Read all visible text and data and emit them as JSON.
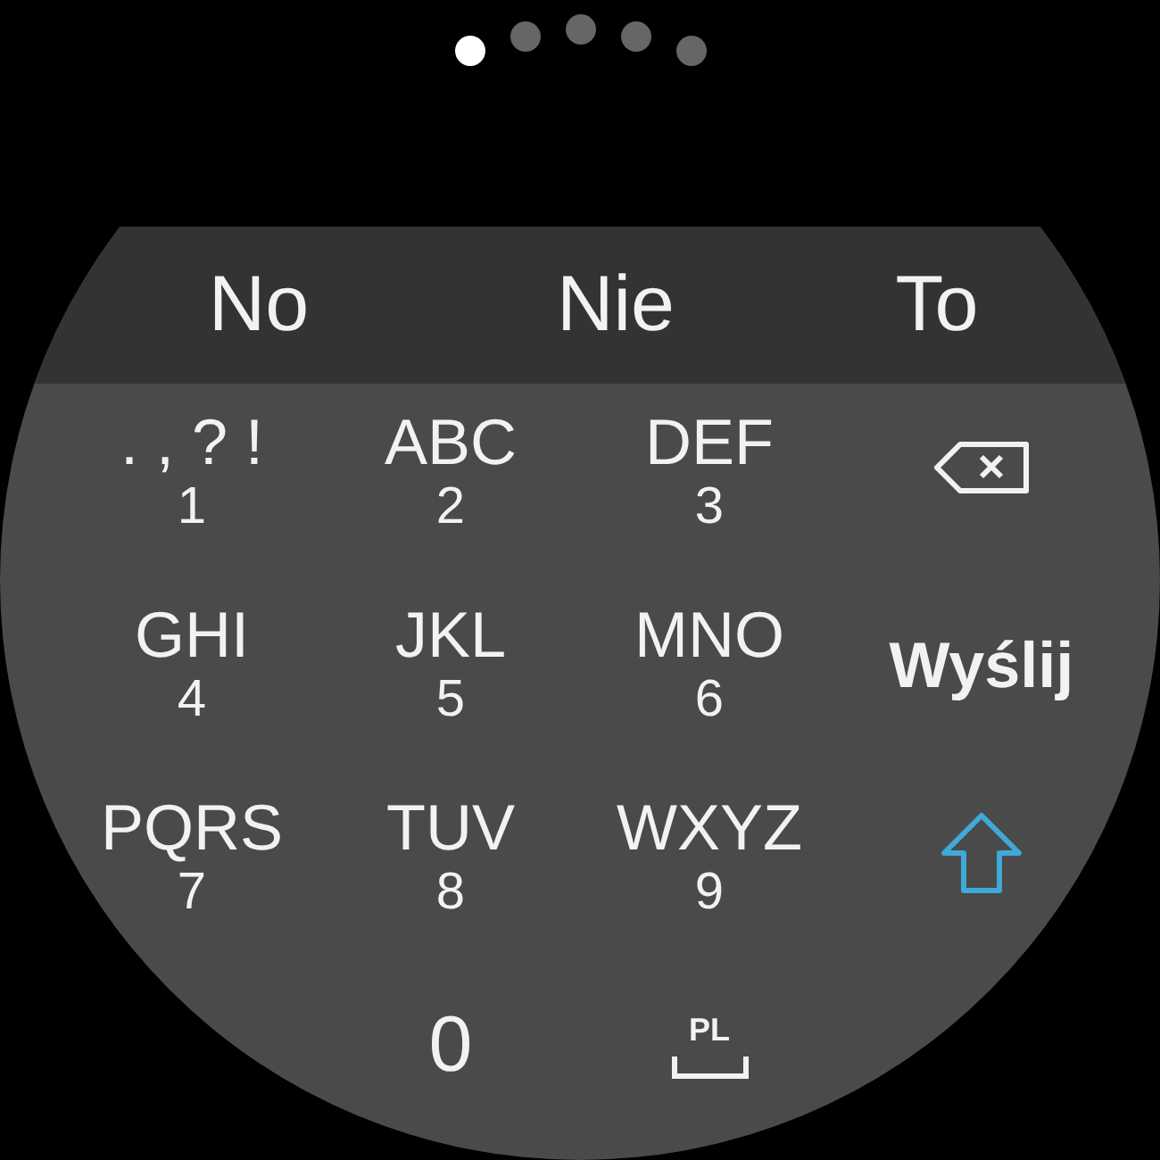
{
  "page_indicator": [
    {
      "selected": true
    },
    {
      "selected": false
    },
    {
      "selected": false
    },
    {
      "selected": false
    },
    {
      "selected": false
    }
  ],
  "suggestions": [
    "No",
    "Nie",
    "To"
  ],
  "rows": [
    [
      {
        "kind": "multi",
        "letters": ". , ? !",
        "digit": "1"
      },
      {
        "kind": "multi",
        "letters": "ABC",
        "digit": "2"
      },
      {
        "kind": "multi",
        "letters": "DEF",
        "digit": "3"
      },
      {
        "kind": "backspace"
      }
    ],
    [
      {
        "kind": "multi",
        "letters": "GHI",
        "digit": "4"
      },
      {
        "kind": "multi",
        "letters": "JKL",
        "digit": "5"
      },
      {
        "kind": "multi",
        "letters": "MNO",
        "digit": "6"
      },
      {
        "kind": "text",
        "label": "Wyślij"
      }
    ],
    [
      {
        "kind": "multi",
        "letters": "PQRS",
        "digit": "7"
      },
      {
        "kind": "multi",
        "letters": "TUV",
        "digit": "8"
      },
      {
        "kind": "multi",
        "letters": "WXYZ",
        "digit": "9"
      },
      {
        "kind": "shift"
      }
    ],
    [
      {
        "kind": "digit",
        "label": "0"
      },
      {
        "kind": "space",
        "label": "PL"
      }
    ]
  ]
}
